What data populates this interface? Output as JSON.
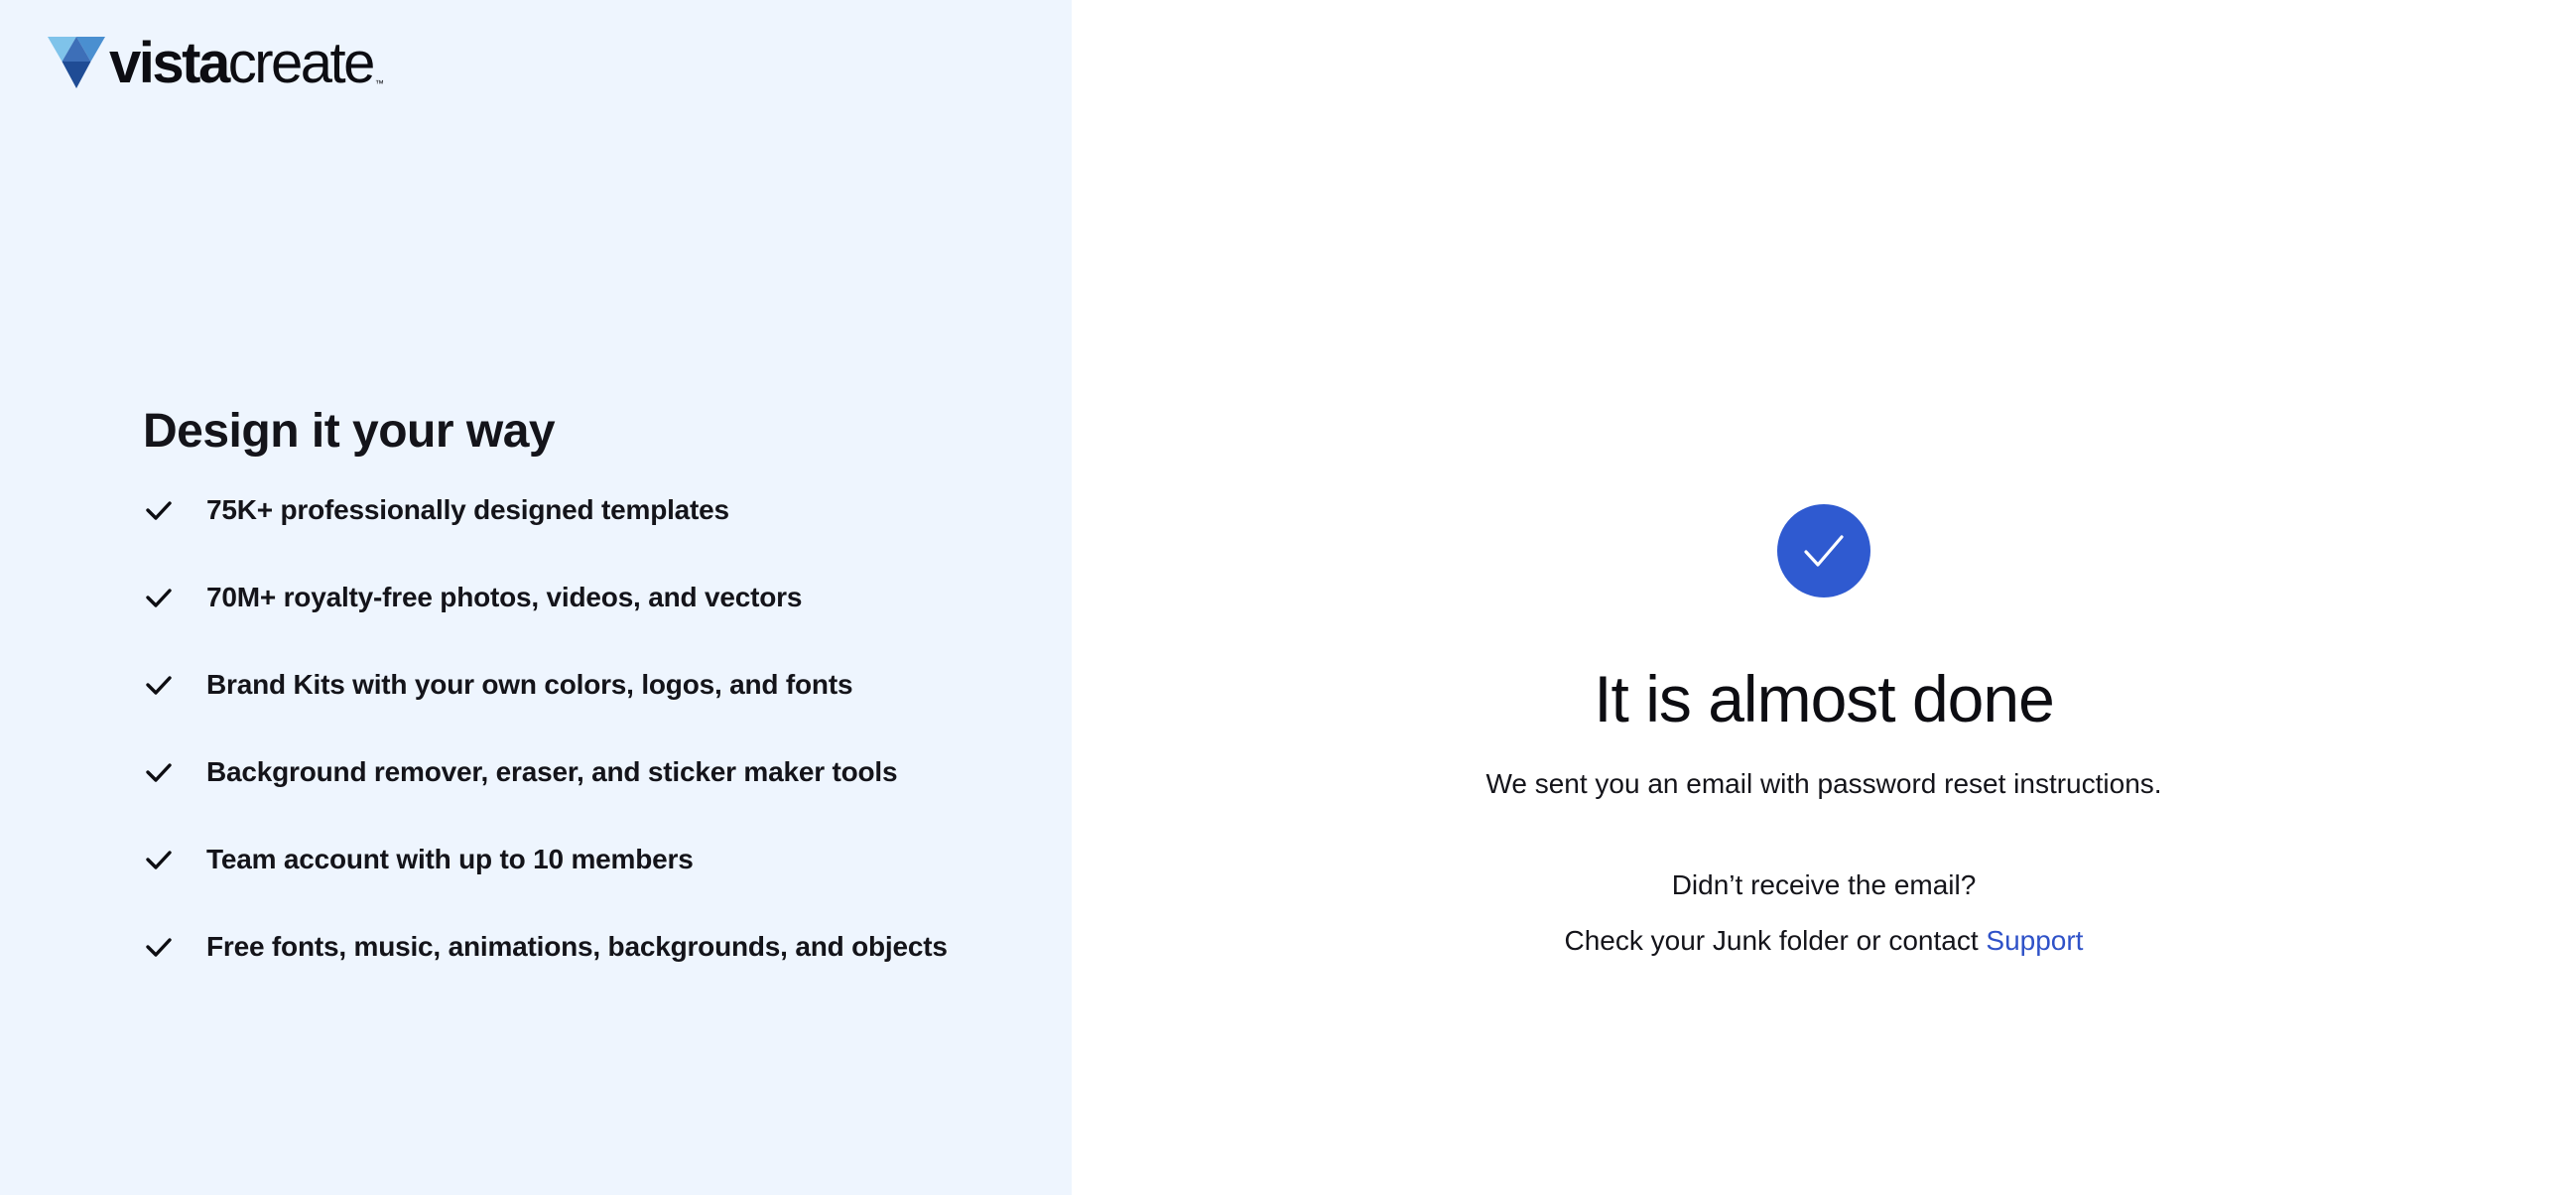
{
  "brand": {
    "name_bold": "vista",
    "name_light": "create",
    "trademark": "™",
    "logo_icon": "vistacreate-triangle-logo-icon"
  },
  "features": {
    "title": "Design it your way",
    "items": [
      {
        "label": "75K+ professionally designed templates",
        "icon": "check-icon"
      },
      {
        "label": "70M+ royalty-free photos, videos, and vectors",
        "icon": "check-icon"
      },
      {
        "label": "Brand Kits with your own colors, logos, and fonts",
        "icon": "check-icon"
      },
      {
        "label": "Background remover, eraser, and sticker maker tools",
        "icon": "check-icon"
      },
      {
        "label": "Team account with up to 10 members",
        "icon": "check-icon"
      },
      {
        "label": "Free fonts, music, animations, backgrounds, and objects",
        "icon": "check-icon"
      }
    ]
  },
  "confirmation": {
    "icon": "check-circle-icon",
    "title": "It is almost done",
    "subtitle": "We sent you an email with password reset instructions.",
    "question": "Didn’t receive the email?",
    "hint_prefix": "Check your Junk folder or contact ",
    "support_link": "Support"
  },
  "colors": {
    "left_panel_bg": "#eef5fe",
    "accent_blue": "#2f5ad0",
    "link_blue": "#2f52c8",
    "text_dark": "#14141a"
  }
}
